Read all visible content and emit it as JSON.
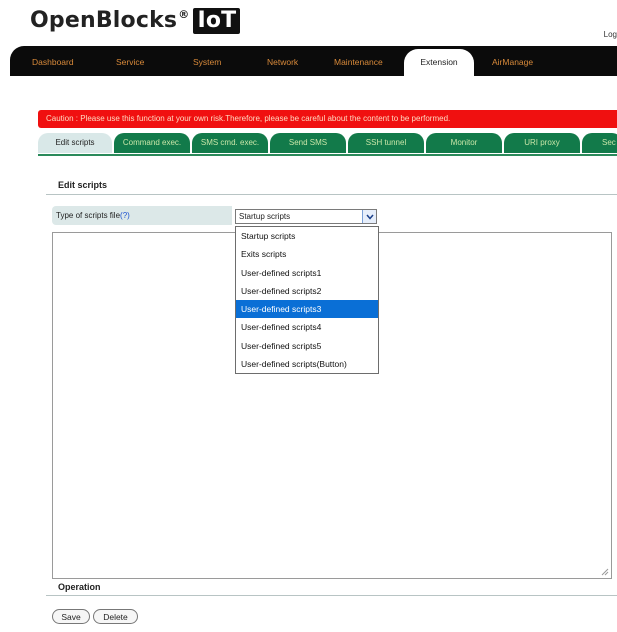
{
  "header": {
    "logo_text": "OpenBlocks",
    "logo_reg": "®",
    "logo_badge": "IoT",
    "login_text": "Log"
  },
  "nav": {
    "items": [
      "Dashboard",
      "Service",
      "System",
      "Network",
      "Maintenance",
      "Extension",
      "AirManage"
    ],
    "active": "Extension"
  },
  "caution": "Caution : Please use this function at your own risk.Therefore, please be careful about the content to be performed.",
  "tabs": {
    "items": [
      "Edit scripts",
      "Command exec.",
      "SMS cmd. exec.",
      "Send SMS",
      "SSH tunnel",
      "Monitor",
      "URI proxy",
      "Sec"
    ],
    "active": "Edit scripts"
  },
  "edit_scripts": {
    "heading": "Edit scripts",
    "type_label": "Type of scripts file",
    "help_link": "(?)",
    "selected_value": "Startup scripts",
    "options": [
      "Startup scripts",
      "Exits scripts",
      "User-defined scripts1",
      "User-defined scripts2",
      "User-defined scripts3",
      "User-defined scripts4",
      "User-defined scripts5",
      "User-defined scripts(Button)"
    ],
    "highlighted_option": "User-defined scripts3",
    "script_content": ""
  },
  "operation": {
    "heading": "Operation",
    "save_label": "Save",
    "delete_label": "Delete"
  },
  "colors": {
    "nav_bg": "#0b0b0b",
    "nav_text": "#d98a3a",
    "caution_bg": "#f01010",
    "tab_bg": "#127a4a",
    "tab_text": "#c9e6a8",
    "highlight": "#0a6fd6"
  }
}
